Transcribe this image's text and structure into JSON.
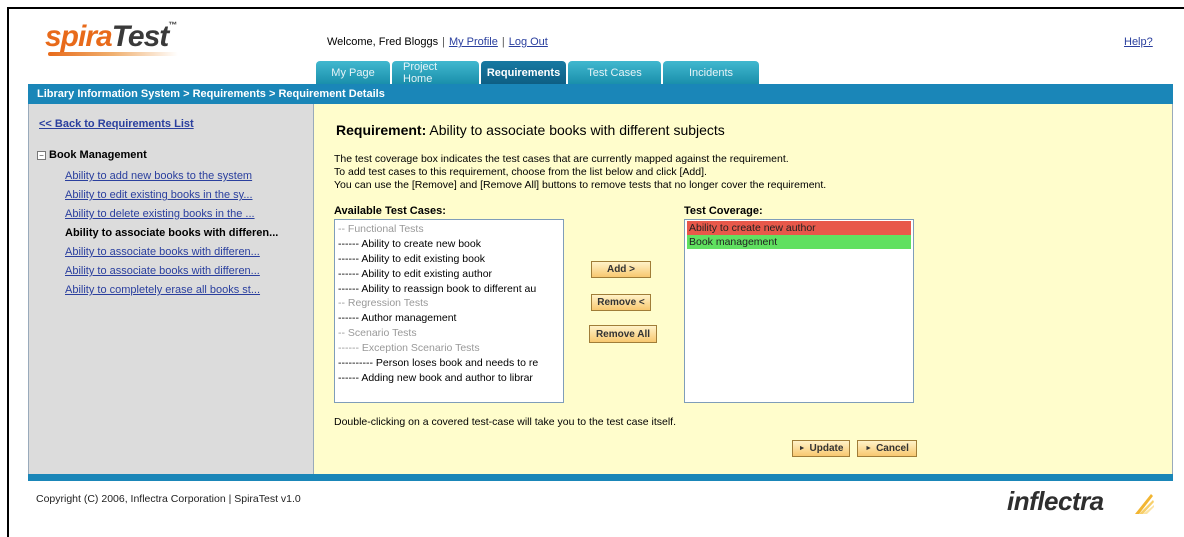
{
  "header": {
    "logo_brand": "spira",
    "logo_product": "Test",
    "logo_tm": "™",
    "welcome_text": "Welcome, Fred Bloggs",
    "my_profile": "My Profile",
    "log_out": "Log Out",
    "help": "Help?"
  },
  "tabs": [
    {
      "label": "My Page"
    },
    {
      "label": "Project Home"
    },
    {
      "label": "Requirements"
    },
    {
      "label": "Test Cases"
    },
    {
      "label": "Incidents"
    }
  ],
  "breadcrumb": "Library Information System > Requirements > Requirement Details",
  "sidebar": {
    "back_link": "<< Back to Requirements List",
    "toggle": "−",
    "root": "Book Management",
    "items": [
      {
        "label": "Ability to add new books to the system"
      },
      {
        "label": "Ability to edit existing books in the sy..."
      },
      {
        "label": "Ability to delete existing books in the ..."
      },
      {
        "label": "Ability to associate books with differen..."
      },
      {
        "label": "Ability to associate books with differen..."
      },
      {
        "label": "Ability to associate books with differen..."
      },
      {
        "label": "Ability to completely erase all books st..."
      }
    ]
  },
  "main": {
    "title_prefix": "Requirement:",
    "title_value": "Ability to associate books with different subjects",
    "instructions": [
      "The test coverage box indicates the test cases that are currently mapped against the requirement.",
      "To add test cases to this requirement, choose from the list below and click [Add].",
      "You can use the [Remove] and [Remove All] buttons to remove tests that no longer cover the requirement."
    ],
    "available_label": "Available Test Cases:",
    "coverage_label": "Test Coverage:",
    "available": [
      {
        "text": "-- Functional Tests",
        "folder": true
      },
      {
        "text": "------ Ability to create new book",
        "folder": false
      },
      {
        "text": "------ Ability to edit existing book",
        "folder": false
      },
      {
        "text": "------ Ability to edit existing author",
        "folder": false
      },
      {
        "text": "------ Ability to reassign book to different au",
        "folder": false
      },
      {
        "text": "-- Regression Tests",
        "folder": true
      },
      {
        "text": "------ Author management",
        "folder": false
      },
      {
        "text": "-- Scenario Tests",
        "folder": true
      },
      {
        "text": "------ Exception Scenario Tests",
        "folder": true
      },
      {
        "text": "---------- Person loses book and needs to re",
        "folder": false
      },
      {
        "text": "------ Adding new book and author to librar",
        "folder": false
      }
    ],
    "coverage": [
      {
        "text": "Ability to create new author",
        "status": "fail"
      },
      {
        "text": "Book management",
        "status": "pass"
      }
    ],
    "add_button": "Add >",
    "remove_button": "Remove <",
    "remove_all_button": "Remove All",
    "note": "Double-clicking on a covered test-case will take you to the test case itself.",
    "update_button": "Update",
    "cancel_button": "Cancel"
  },
  "footer": {
    "copyright": "Copyright (C) 2006, Inflectra Corporation | SpiraTest v1.0",
    "brand": "inflectra"
  },
  "colors": {
    "accent": "#1a86b8",
    "left_panel": "#dcdcdc",
    "right_panel": "#fffdcc",
    "fail": "#e8584a",
    "pass": "#60e060"
  }
}
